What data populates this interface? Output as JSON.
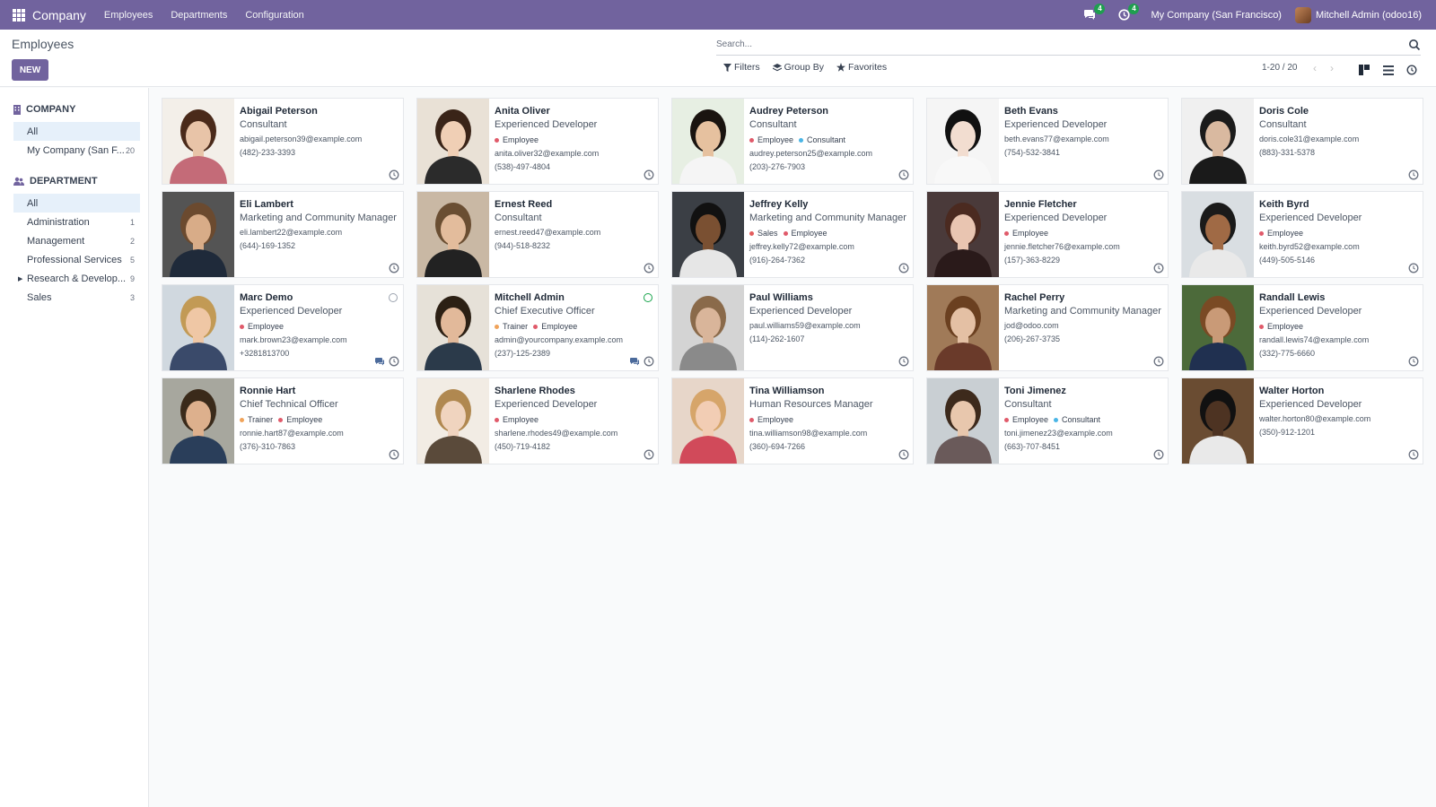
{
  "navbar": {
    "app_name": "Company",
    "menus": [
      "Employees",
      "Departments",
      "Configuration"
    ],
    "messages_badge": "4",
    "activities_badge": "4",
    "company": "My Company (San Francisco)",
    "user": "Mitchell Admin (odoo16)"
  },
  "control_panel": {
    "title": "Employees",
    "new_label": "NEW",
    "search_placeholder": "Search...",
    "filters_label": "Filters",
    "groupby_label": "Group By",
    "favorites_label": "Favorites",
    "pager": "1-20 / 20"
  },
  "sidebar": {
    "company_header": "COMPANY",
    "company_items": [
      {
        "label": "All",
        "count": ""
      },
      {
        "label": "My Company (San F...",
        "count": "20"
      }
    ],
    "department_header": "DEPARTMENT",
    "department_items": [
      {
        "label": "All",
        "count": ""
      },
      {
        "label": "Administration",
        "count": "1"
      },
      {
        "label": "Management",
        "count": "2"
      },
      {
        "label": "Professional Services",
        "count": "5"
      },
      {
        "label": "Research & Develop...",
        "count": "9"
      },
      {
        "label": "Sales",
        "count": "3"
      }
    ]
  },
  "colors": {
    "brand": "#71639e",
    "tag_employee": "#e05a6a",
    "tag_consultant": "#4ab5e6",
    "tag_trainer": "#f0a35a",
    "tag_sales": "#e35d5d"
  },
  "employees": [
    {
      "name": "Abigail Peterson",
      "job": "Consultant",
      "tags": [],
      "email": "abigail.peterson39@example.com",
      "phone": "(482)-233-3393"
    },
    {
      "name": "Anita Oliver",
      "job": "Experienced Developer",
      "tags": [
        "Employee"
      ],
      "email": "anita.oliver32@example.com",
      "phone": "(538)-497-4804"
    },
    {
      "name": "Audrey Peterson",
      "job": "Consultant",
      "tags": [
        "Employee",
        "Consultant"
      ],
      "email": "audrey.peterson25@example.com",
      "phone": "(203)-276-7903"
    },
    {
      "name": "Beth Evans",
      "job": "Experienced Developer",
      "tags": [],
      "email": "beth.evans77@example.com",
      "phone": "(754)-532-3841"
    },
    {
      "name": "Doris Cole",
      "job": "Consultant",
      "tags": [],
      "email": "doris.cole31@example.com",
      "phone": "(883)-331-5378"
    },
    {
      "name": "Eli Lambert",
      "job": "Marketing and Community Manager",
      "tags": [],
      "email": "eli.lambert22@example.com",
      "phone": "(644)-169-1352"
    },
    {
      "name": "Ernest Reed",
      "job": "Consultant",
      "tags": [],
      "email": "ernest.reed47@example.com",
      "phone": "(944)-518-8232"
    },
    {
      "name": "Jeffrey Kelly",
      "job": "Marketing and Community Manager",
      "tags": [
        "Sales",
        "Employee"
      ],
      "email": "jeffrey.kelly72@example.com",
      "phone": "(916)-264-7362"
    },
    {
      "name": "Jennie Fletcher",
      "job": "Experienced Developer",
      "tags": [
        "Employee"
      ],
      "email": "jennie.fletcher76@example.com",
      "phone": "(157)-363-8229"
    },
    {
      "name": "Keith Byrd",
      "job": "Experienced Developer",
      "tags": [
        "Employee"
      ],
      "email": "keith.byrd52@example.com",
      "phone": "(449)-505-5146"
    },
    {
      "name": "Marc Demo",
      "job": "Experienced Developer",
      "tags": [
        "Employee"
      ],
      "email": "mark.brown23@example.com",
      "phone": "+3281813700"
    },
    {
      "name": "Mitchell Admin",
      "job": "Chief Executive Officer",
      "tags": [
        "Trainer",
        "Employee"
      ],
      "email": "admin@yourcompany.example.com",
      "phone": "(237)-125-2389"
    },
    {
      "name": "Paul Williams",
      "job": "Experienced Developer",
      "tags": [],
      "email": "paul.williams59@example.com",
      "phone": "(114)-262-1607"
    },
    {
      "name": "Rachel Perry",
      "job": "Marketing and Community Manager",
      "tags": [],
      "email": "jod@odoo.com",
      "phone": "(206)-267-3735"
    },
    {
      "name": "Randall Lewis",
      "job": "Experienced Developer",
      "tags": [
        "Employee"
      ],
      "email": "randall.lewis74@example.com",
      "phone": "(332)-775-6660"
    },
    {
      "name": "Ronnie Hart",
      "job": "Chief Technical Officer",
      "tags": [
        "Trainer",
        "Employee"
      ],
      "email": "ronnie.hart87@example.com",
      "phone": "(376)-310-7863"
    },
    {
      "name": "Sharlene Rhodes",
      "job": "Experienced Developer",
      "tags": [
        "Employee"
      ],
      "email": "sharlene.rhodes49@example.com",
      "phone": "(450)-719-4182"
    },
    {
      "name": "Tina Williamson",
      "job": "Human Resources Manager",
      "tags": [
        "Employee"
      ],
      "email": "tina.williamson98@example.com",
      "phone": "(360)-694-7266"
    },
    {
      "name": "Toni Jimenez",
      "job": "Consultant",
      "tags": [
        "Employee",
        "Consultant"
      ],
      "email": "toni.jimenez23@example.com",
      "phone": "(663)-707-8451"
    },
    {
      "name": "Walter Horton",
      "job": "Experienced Developer",
      "tags": [],
      "email": "walter.horton80@example.com",
      "phone": "(350)-912-1201"
    }
  ]
}
